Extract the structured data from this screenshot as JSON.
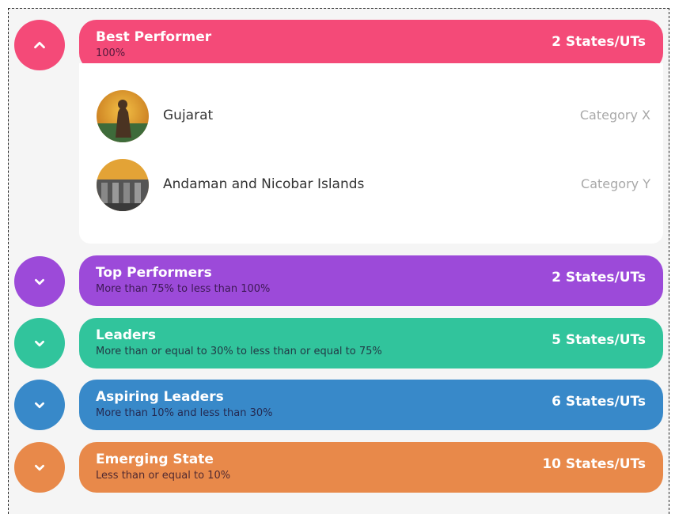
{
  "colors": {
    "best": "#f44a78",
    "top": "#9c4ad9",
    "leaders": "#31c49c",
    "aspiring": "#3889c9",
    "emerging": "#e8894a"
  },
  "best": {
    "title": "Best Performer",
    "subtitle": "100%",
    "count": "2 States/UTs",
    "expanded": true,
    "items": [
      {
        "name": "Gujarat",
        "category": "Category X"
      },
      {
        "name": "Andaman and Nicobar Islands",
        "category": "Category Y"
      }
    ]
  },
  "top": {
    "title": "Top Performers",
    "subtitle": "More than 75% to less than 100%",
    "count": "2 States/UTs",
    "expanded": false
  },
  "leaders": {
    "title": "Leaders",
    "subtitle": "More than or equal to 30% to less than or equal to 75%",
    "count": "5 States/UTs",
    "expanded": false
  },
  "aspiring": {
    "title": "Aspiring Leaders",
    "subtitle": "More than 10% and less than 30%",
    "count": "6 States/UTs",
    "expanded": false
  },
  "emerging": {
    "title": "Emerging State",
    "subtitle": "Less than or equal to 10%",
    "count": "10 States/UTs",
    "expanded": false
  }
}
